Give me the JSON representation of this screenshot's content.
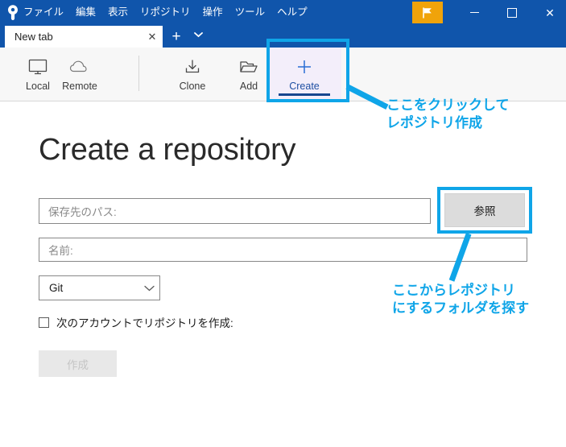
{
  "window": {
    "app_icon": "sourcetree-logo-icon",
    "menu": [
      {
        "label": "ファイル"
      },
      {
        "label": "編集"
      },
      {
        "label": "表示"
      },
      {
        "label": "リポジトリ"
      },
      {
        "label": "操作"
      },
      {
        "label": "ツール"
      },
      {
        "label": "ヘルプ"
      }
    ],
    "flag_button_icon": "flag-icon",
    "flag_button_color": "#f0a30a",
    "minimize_icon": "minimize-icon",
    "maximize_icon": "maximize-icon",
    "close_icon": "close-icon",
    "titlebar_color": "#1055ab"
  },
  "tabs": {
    "items": [
      {
        "label": "New tab",
        "close_icon": "close-icon",
        "active": true
      }
    ],
    "new_tab_label": "+",
    "tab_list_chevron_icon": "chevron-down-icon"
  },
  "toolbar": {
    "items": [
      {
        "label": "Local",
        "icon": "monitor-icon",
        "active": false
      },
      {
        "label": "Remote",
        "icon": "cloud-icon",
        "active": false
      },
      {
        "label": "Clone",
        "icon": "download-icon",
        "active": false
      },
      {
        "label": "Add",
        "icon": "folder-open-icon",
        "active": false
      },
      {
        "label": "Create",
        "icon": "plus-icon",
        "active": true
      }
    ],
    "active_color": "#1e4fa3",
    "active_bg": "#f3eefa"
  },
  "main": {
    "title": "Create a repository",
    "path_field": {
      "placeholder": "保存先のパス:",
      "value": ""
    },
    "name_field": {
      "placeholder": "名前:",
      "value": ""
    },
    "browse_button": {
      "label": "参照"
    },
    "vcs_select": {
      "value": "Git",
      "chevron_icon": "chevron-down-icon"
    },
    "account_checkbox": {
      "label": "次のアカウントでリポジトリを作成:",
      "checked": false
    },
    "create_button": {
      "label": "作成",
      "enabled": false
    }
  },
  "annotations": {
    "accent_color": "#0fa5e8",
    "callout_create": "ここをクリックして\nレポジトリ作成",
    "callout_browse": "ここからレポジトリ\nにするフォルダを探す"
  }
}
